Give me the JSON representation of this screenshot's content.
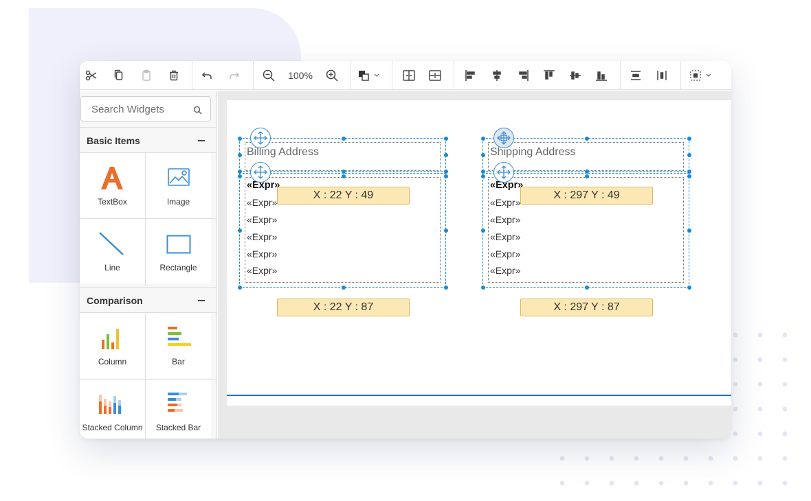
{
  "toolbar": {
    "zoom": "100%",
    "buttons": [
      "cut-icon",
      "copy-icon",
      "paste-icon",
      "delete-icon",
      "undo-icon",
      "redo-icon",
      "zoom-out-icon",
      "zoom-in-icon",
      "order-icon",
      "group-icon",
      "ungroup-icon",
      "align-left-icon",
      "align-center-icon",
      "align-right-icon",
      "align-top-icon",
      "align-middle-icon",
      "align-bottom-icon",
      "distribute-horizontal-icon",
      "distribute-vertical-icon",
      "size-icon"
    ]
  },
  "sidebar": {
    "search_placeholder": "Search Widgets",
    "sections": [
      {
        "title": "Basic Items",
        "items": [
          "TextBox",
          "Image",
          "Line",
          "Rectangle"
        ]
      },
      {
        "title": "Comparison",
        "items": [
          "Column",
          "Bar",
          "Stacked Column",
          "Stacked Bar"
        ]
      }
    ]
  },
  "canvas": {
    "billing": {
      "heading": "Billing Address",
      "fields": [
        "«Expr»",
        "«Expr»",
        "«Expr»",
        "«Expr»",
        "«Expr»",
        "«Expr»"
      ],
      "tip_top": "X : 22  Y : 49",
      "tip_bottom": "X : 22  Y : 87"
    },
    "shipping": {
      "heading": "Shipping Address",
      "fields": [
        "«Expr»",
        "«Expr»",
        "«Expr»",
        "«Expr»",
        "«Expr»",
        "«Expr»"
      ],
      "tip_top": "X : 297  Y : 49",
      "tip_bottom": "X : 297  Y : 87"
    }
  },
  "colors": {
    "accent": "#1a8ad6",
    "tooltip": "#fbe8b4",
    "page_border": "#1e73d8"
  }
}
